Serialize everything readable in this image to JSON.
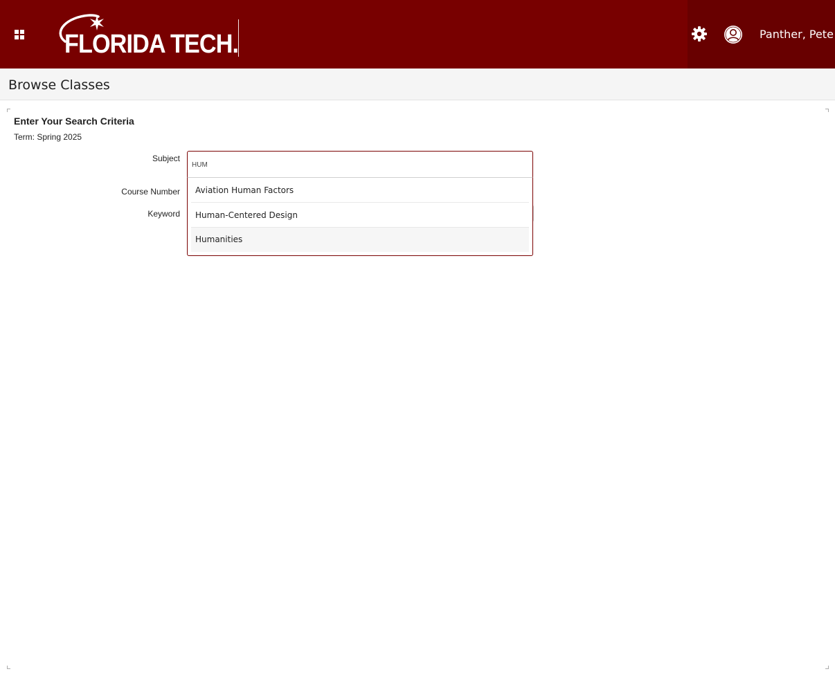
{
  "header": {
    "logo_text": "FLORIDA TECH.",
    "user_name": "Panther, Pete",
    "colors": {
      "primary": "#780000",
      "secondary": "#680000"
    },
    "icons": [
      "app-grid-icon",
      "gear-icon",
      "user-avatar-icon"
    ]
  },
  "page": {
    "title": "Browse Classes"
  },
  "search": {
    "heading": "Enter Your Search Criteria",
    "term": "Term: Spring 2025",
    "subject_label": "Subject",
    "course_number_label": "Course Number",
    "keyword_label": "Keyword",
    "subject_value": "HUM",
    "suggestions": [
      "Aviation Human Factors",
      "Human-Centered Design",
      "Humanities"
    ]
  }
}
